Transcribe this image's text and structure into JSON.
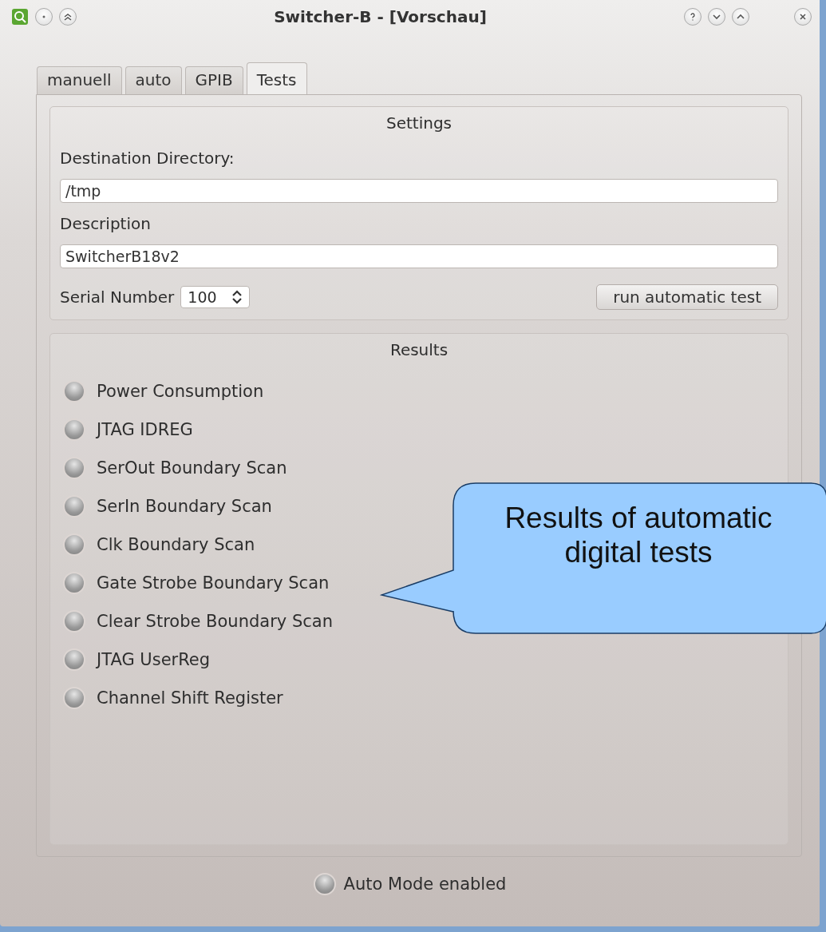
{
  "window": {
    "title": "Switcher-B - [Vorschau]"
  },
  "tabs": [
    {
      "label": "manuell",
      "selected": false
    },
    {
      "label": "auto",
      "selected": false
    },
    {
      "label": "GPIB",
      "selected": false
    },
    {
      "label": "Tests",
      "selected": true
    }
  ],
  "settings": {
    "title": "Settings",
    "destination_label": "Destination Directory:",
    "destination_value": "/tmp",
    "description_label": "Description",
    "description_value": "SwitcherB18v2",
    "serial_label": "Serial Number",
    "serial_value": "100",
    "run_button": "run automatic test"
  },
  "results": {
    "title": "Results",
    "items": [
      {
        "label": "Power Consumption",
        "on": false
      },
      {
        "label": "JTAG IDREG",
        "on": false
      },
      {
        "label": "SerOut Boundary Scan",
        "on": false
      },
      {
        "label": "SerIn Boundary Scan",
        "on": false
      },
      {
        "label": "Clk Boundary Scan",
        "on": false
      },
      {
        "label": "Gate Strobe Boundary Scan",
        "on": false
      },
      {
        "label": "Clear Strobe Boundary Scan",
        "on": false
      },
      {
        "label": "JTAG UserReg",
        "on": false
      },
      {
        "label": "Channel Shift Register",
        "on": false
      }
    ]
  },
  "auto_mode": {
    "label": "Auto Mode enabled",
    "on": false
  },
  "callout": {
    "text": "Results of automatic digital tests"
  }
}
